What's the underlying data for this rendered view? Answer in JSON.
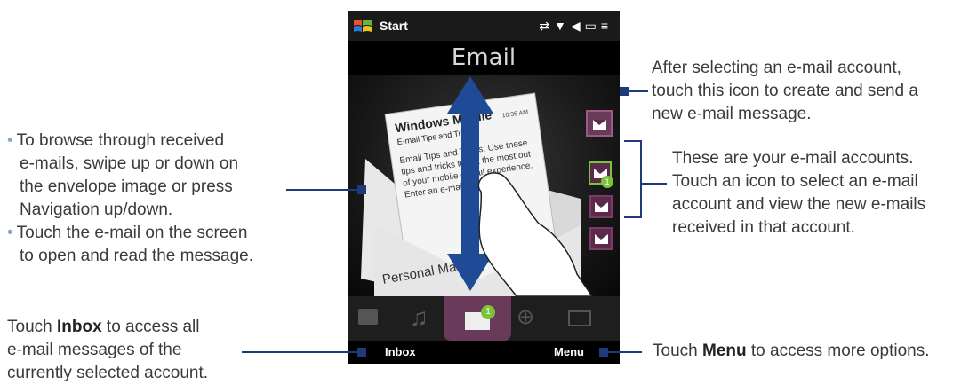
{
  "phone": {
    "status": {
      "start_label": "Start"
    },
    "tab_title": "Email",
    "email_card": {
      "sender": "Windows Mobile",
      "subject": "E-mail Tips and Tricks",
      "time": "10:35 AM",
      "body": "Email Tips and Tricks: Use these tips and tricks to get the most out of your mobile e-mail experience. Enter an e-mail...",
      "folder_label": "Personal Mail 2"
    },
    "accounts": [
      {
        "badge": "1",
        "selected": true
      },
      {
        "badge": "",
        "selected": false
      },
      {
        "badge": "",
        "selected": false
      }
    ],
    "tabbar": {
      "active_badge": "1",
      "icons": [
        "message-icon",
        "music-icon",
        "email-icon",
        "internet-icon",
        "camera-icon"
      ]
    },
    "softkeys": {
      "left": "Inbox",
      "right": "Menu"
    }
  },
  "annotations": {
    "compose_note": [
      "After selecting an e-mail account,",
      "touch this icon to create and send a",
      "new e-mail message."
    ],
    "accounts_note": [
      "These are your e-mail accounts.",
      "Touch an icon to select an e-mail",
      "account and view the new e-mails",
      "received in that account."
    ],
    "browse_note": {
      "bullet1": [
        "To browse through received",
        "e-mails, swipe up or down on",
        "the envelope image or press",
        "Navigation up/down."
      ],
      "bullet2": [
        "Touch the e-mail on the screen",
        "to open and read the message."
      ]
    },
    "inbox_note": {
      "pre": "Touch ",
      "bold": "Inbox",
      "post": " to access all",
      "line2": "e-mail messages of the",
      "line3": "currently selected account."
    },
    "menu_note": {
      "pre": "Touch ",
      "bold": "Menu",
      "post": " to access more options."
    }
  },
  "colors": {
    "accent": "#1e3a7a",
    "arrow": "#1f4a96",
    "tab_active": "#6a3a5a",
    "account_selected": "#7cc33a"
  }
}
